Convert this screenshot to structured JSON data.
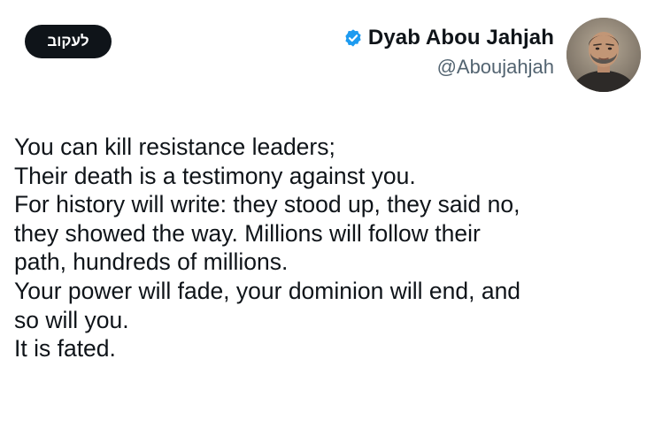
{
  "tweet": {
    "follow_label": "לעקוב",
    "author": {
      "display_name": "Dyab Abou Jahjah",
      "handle": "@Aboujahjah",
      "verified_color": "#1d9bf0"
    },
    "avatar_icon": "profile-photo",
    "lines": [
      "You can kill resistance leaders;",
      "Their death is a testimony against you.",
      "For history will write: they stood up, they said no,",
      "they showed the way. Millions will follow their",
      "path, hundreds of millions.",
      "Your power will fade, your dominion will end, and",
      "so will you.",
      "It is fated."
    ]
  }
}
